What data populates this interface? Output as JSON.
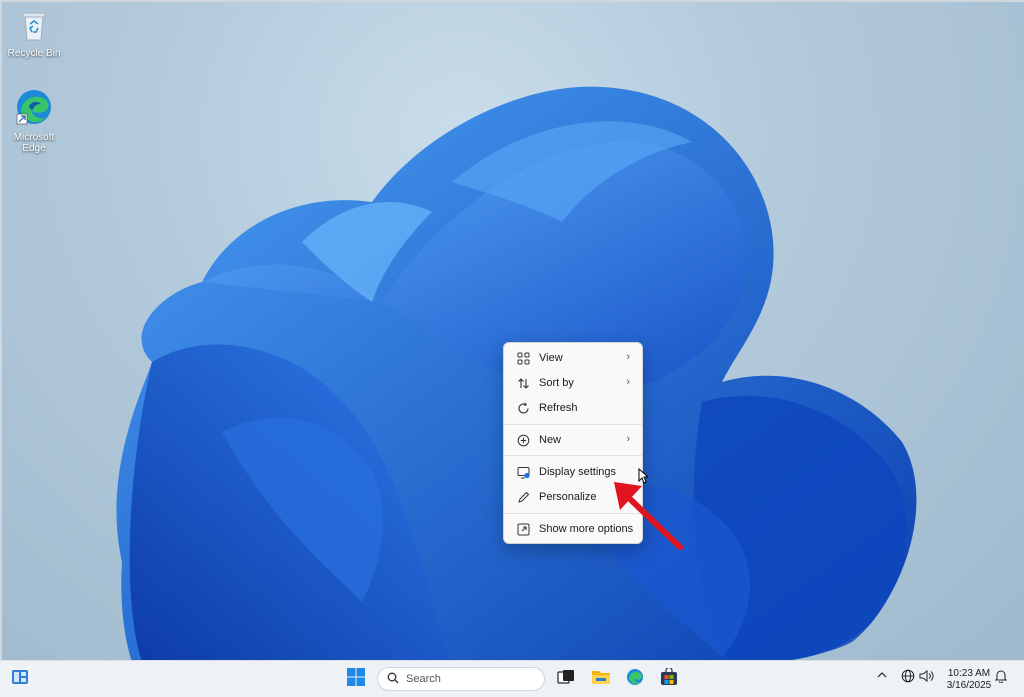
{
  "desktop": {
    "icons": [
      {
        "name": "recycle-bin",
        "label": "Recycle Bin"
      },
      {
        "name": "edge",
        "label": "Microsoft Edge"
      }
    ]
  },
  "context_menu": {
    "items": [
      {
        "label": "View",
        "icon": "grid-icon",
        "submenu": true
      },
      {
        "label": "Sort by",
        "icon": "sort-icon",
        "submenu": true
      },
      {
        "label": "Refresh",
        "icon": "refresh-icon",
        "submenu": false
      },
      {
        "label": "New",
        "icon": "plus-circle-icon",
        "submenu": true
      },
      {
        "label": "Display settings",
        "icon": "display-icon",
        "submenu": false
      },
      {
        "label": "Personalize",
        "icon": "pen-icon",
        "submenu": false
      },
      {
        "label": "Show more options",
        "icon": "expand-icon",
        "submenu": false
      }
    ],
    "chevron": "›"
  },
  "taskbar": {
    "search_placeholder": "Search",
    "clock_time": "10:23 AM",
    "clock_date": "3/16/2025"
  },
  "colors": {
    "accent": "#1f6fe5",
    "arrow": "#e0141e",
    "bloom_dark": "#0a3fb5",
    "bloom_light": "#3a8cf0"
  }
}
